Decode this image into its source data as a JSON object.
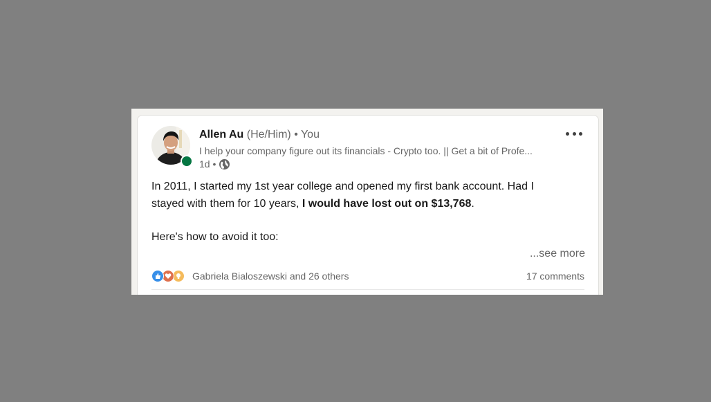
{
  "post": {
    "author_name": "Allen Au",
    "pronouns": "(He/Him)",
    "relation": "• You",
    "headline": "I help your company figure out its financials - Crypto too. || Get a bit of Profe...",
    "time": "1d •",
    "visibility_icon": "globe-icon",
    "body": {
      "line1": "In 2011, I started my 1st year college and opened my first bank account. Had I",
      "line2_start": "stayed with them for 10 years, ",
      "line2_bold": "I would have lost out on $13,768",
      "line2_end": ".",
      "line3": "Here's how to avoid it too:"
    },
    "see_more": "...see more",
    "reactions": {
      "icons": [
        "like-icon",
        "love-icon",
        "insightful-icon"
      ],
      "summary": "Gabriela Bialoszewski and 26 others"
    },
    "comments": "17 comments"
  },
  "colors": {
    "presence": "#057642",
    "like": "#378fe9",
    "love": "#df704d",
    "insightful": "#f5bb5c"
  }
}
